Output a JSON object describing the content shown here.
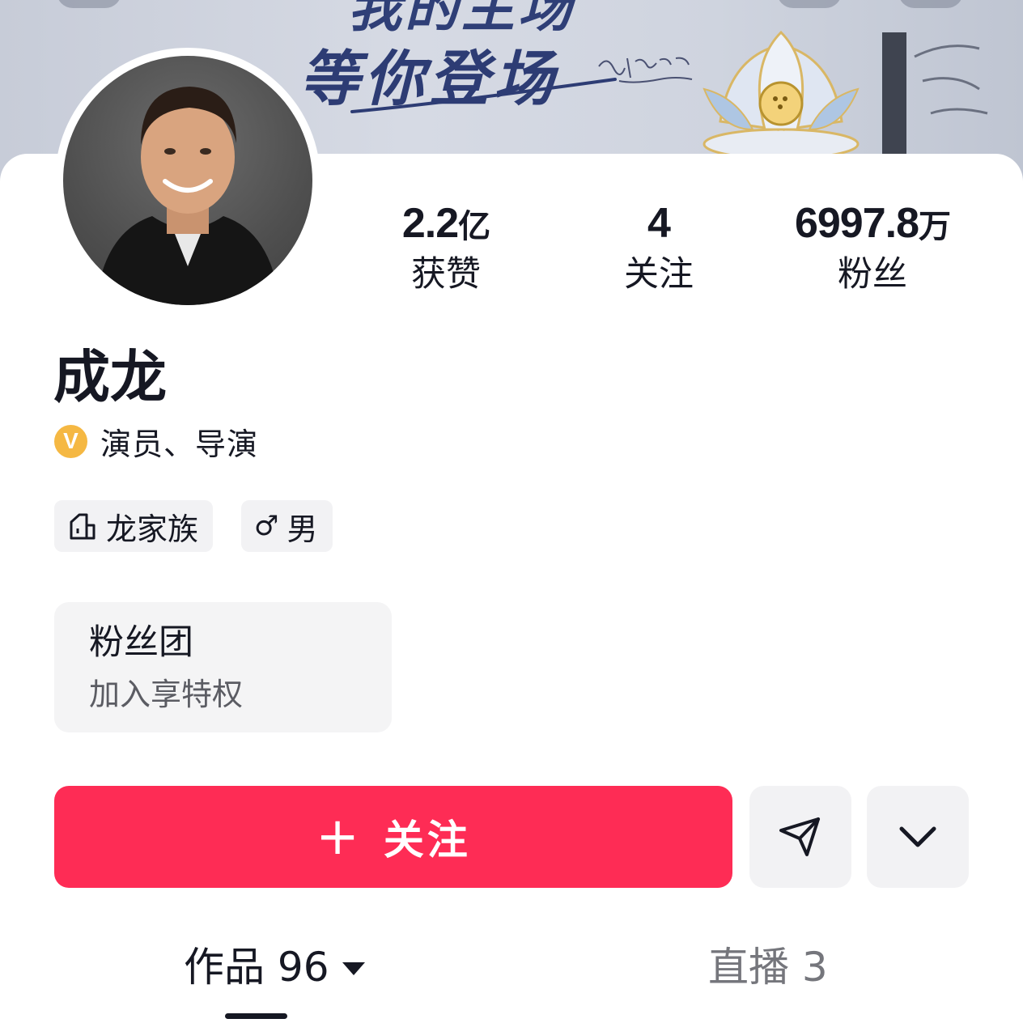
{
  "banner": {
    "line1": "我的主场",
    "line2": "等你登场",
    "signature": "Jackie Chan"
  },
  "profile": {
    "name": "成龙",
    "verification": "演员、导演",
    "verify_badge": "V"
  },
  "stats": [
    {
      "value": "2.2",
      "unit": "亿",
      "label": "获赞"
    },
    {
      "value": "4",
      "unit": "",
      "label": "关注"
    },
    {
      "value": "6997.8",
      "unit": "万",
      "label": "粉丝"
    }
  ],
  "tags": {
    "family": "龙家族",
    "gender_symbol": "♂",
    "gender": "男"
  },
  "fanclub": {
    "title": "粉丝团",
    "subtitle": "加入享特权"
  },
  "actions": {
    "follow_plus": "+",
    "follow_label": "关注"
  },
  "tabs": {
    "works": "作品 96",
    "live": "直播 3"
  },
  "colors": {
    "accent": "#fe2c55",
    "verify_badge": "#f5b843",
    "chip_bg": "#f2f2f4"
  },
  "icons": {
    "family": "family-group-icon",
    "share": "paper-plane-icon",
    "more": "chevron-down-icon",
    "tab_dropdown": "caret-down-icon"
  }
}
